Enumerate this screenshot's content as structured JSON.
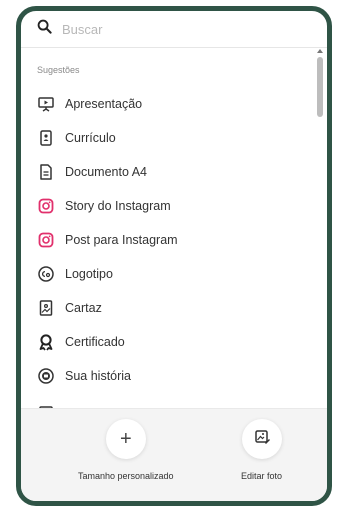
{
  "search": {
    "placeholder": "Buscar"
  },
  "suggestions": {
    "title": "Sugestões",
    "items": [
      {
        "label": "Apresentação",
        "icon": "presentation-icon"
      },
      {
        "label": "Currículo",
        "icon": "resume-icon"
      },
      {
        "label": "Documento A4",
        "icon": "document-icon"
      },
      {
        "label": "Story do Instagram",
        "icon": "instagram-icon"
      },
      {
        "label": "Post para Instagram",
        "icon": "instagram-icon"
      },
      {
        "label": "Logotipo",
        "icon": "logo-icon"
      },
      {
        "label": "Cartaz",
        "icon": "poster-icon"
      },
      {
        "label": "Certificado",
        "icon": "certificate-icon"
      },
      {
        "label": "Sua história",
        "icon": "story-icon"
      }
    ]
  },
  "actions": [
    {
      "label": "Tamanho personalizado",
      "icon": "plus-icon"
    },
    {
      "label": "Editar foto",
      "icon": "edit-photo-icon"
    }
  ],
  "colors": {
    "frame": "#2f5446",
    "instagram": "#e1306c"
  }
}
